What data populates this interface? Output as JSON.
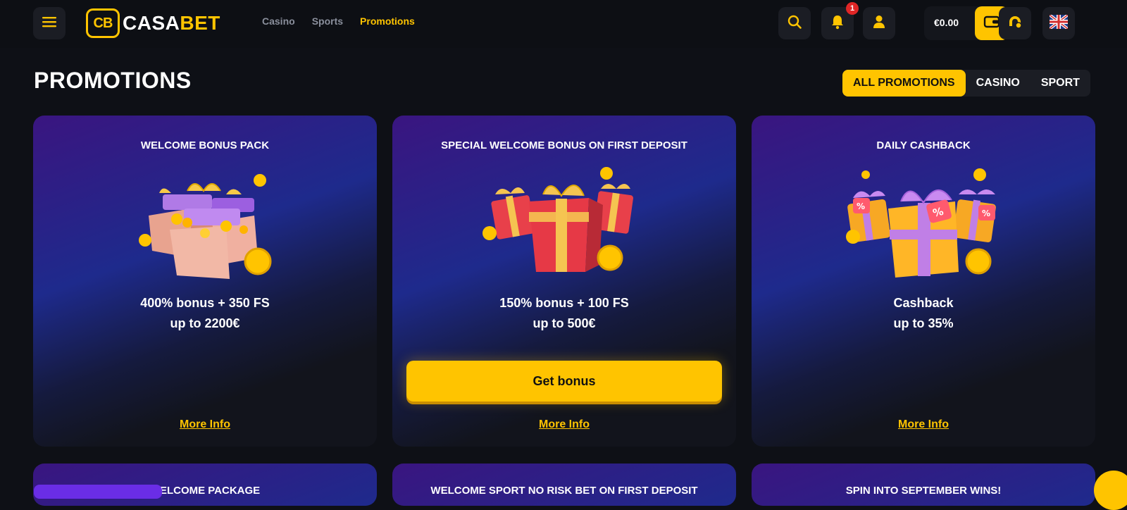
{
  "header": {
    "logo_badge": "CB",
    "logo_casa": "CASA",
    "logo_bet": "BET",
    "nav": [
      {
        "label": "Casino",
        "active": false
      },
      {
        "label": "Sports",
        "active": false
      },
      {
        "label": "Promotions",
        "active": true
      }
    ],
    "notification_count": "1",
    "balance": "€0.00",
    "icons": [
      "menu-icon",
      "search-icon",
      "bell-icon",
      "user-icon",
      "wallet-icon",
      "support-icon",
      "uk-flag-icon"
    ]
  },
  "page": {
    "title": "PROMOTIONS",
    "filters": [
      {
        "label": "ALL PROMOTIONS",
        "active": true
      },
      {
        "label": "CASINO",
        "active": false
      },
      {
        "label": "SPORT",
        "active": false
      }
    ]
  },
  "cards": [
    {
      "title": "WELCOME BONUS PACK",
      "offer_line1": "400% bonus + 350 FS",
      "offer_line2": "up to 2200€",
      "more": "More Info"
    },
    {
      "title": "SPECIAL WELCOME BONUS ON FIRST DEPOSIT",
      "offer_line1": "150% bonus + 100 FS",
      "offer_line2": "up to 500€",
      "button": "Get bonus",
      "more": "More Info"
    },
    {
      "title": "DAILY CASHBACK",
      "offer_line1": "Cashback",
      "offer_line2": "up to 35%",
      "more": "More Info"
    }
  ],
  "cards_row2": [
    {
      "title": "WELCOME PACKAGE"
    },
    {
      "title": "WELCOME SPORT NO RISK BET ON FIRST DEPOSIT"
    },
    {
      "title": "SPIN INTO SEPTEMBER WINS!"
    }
  ],
  "colors": {
    "accent": "#ffc400",
    "background": "#0e1016",
    "notification": "#e02626"
  }
}
